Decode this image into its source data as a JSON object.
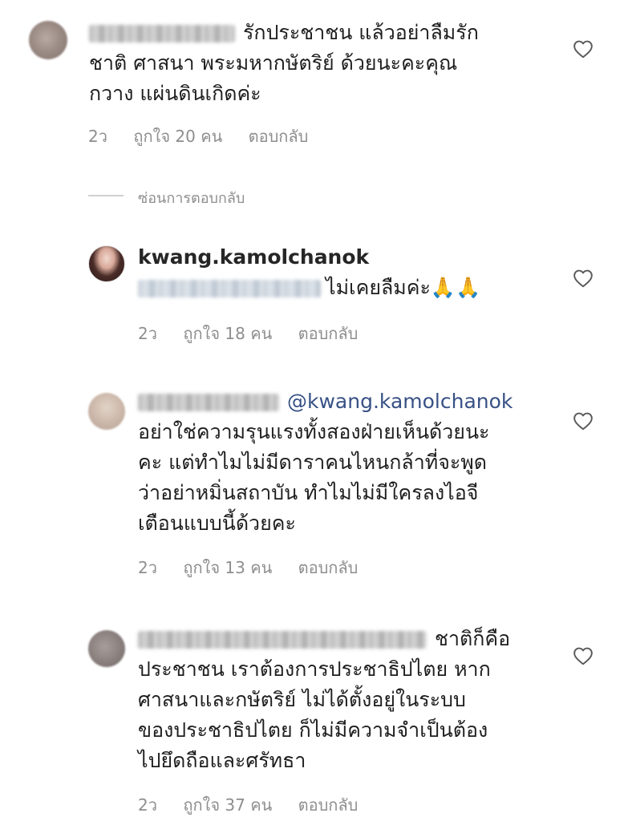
{
  "comments": [
    {
      "text_lines": [
        "รักประชาชน แล้วอย่าลืมรัก",
        "ชาติ ศาสนา พระมหากษัตริย์ ด้วยนะคะคุณ",
        "กวาง แผ่นดินเกิดค่ะ"
      ],
      "meta": {
        "time": "2ว",
        "likes": "ถูกใจ 20 คน",
        "reply": "ตอบกลับ"
      }
    },
    {
      "hide_replies_label": "ซ่อนการตอบกลับ"
    },
    {
      "username": "kwang.kamolchanok",
      "text_lines": [
        "ไม่เคยลืมค่ะ🙏🙏"
      ],
      "meta": {
        "time": "2ว",
        "likes": "ถูกใจ 18 คน",
        "reply": "ตอบกลับ"
      }
    },
    {
      "mention": "@kwang.kamolchanok",
      "text_lines": [
        "อย่าใช่ความรุนแรงทั้งสองฝ่ายเห็นด้วยนะ",
        "คะ แต่ทำไมไม่มีดาราคนไหนกล้าที่จะพูด",
        "ว่าอย่าหมิ่นสถาบัน ทำไมไม่มีใครลงไอจี",
        "เตือนแบบนี้ด้วยคะ"
      ],
      "meta": {
        "time": "2ว",
        "likes": "ถูกใจ 13 คน",
        "reply": "ตอบกลับ"
      }
    },
    {
      "text_lines": [
        "ชาติก็คือ",
        "ประชาชน เราต้องการประชาธิปไตย หาก",
        "ศาสนาและกษัตริย์ ไม่ได้ตั้งอยู่ในระบบ",
        "ของประชาธิปไตย ก็ไม่มีความจำเป็นต้อง",
        "ไปยึดถือและศรัทธา"
      ],
      "meta": {
        "time": "2ว",
        "likes": "ถูกใจ 37 คน",
        "reply": "ตอบกลับ"
      }
    }
  ],
  "icons": {
    "heart": "heart-outline-icon"
  }
}
